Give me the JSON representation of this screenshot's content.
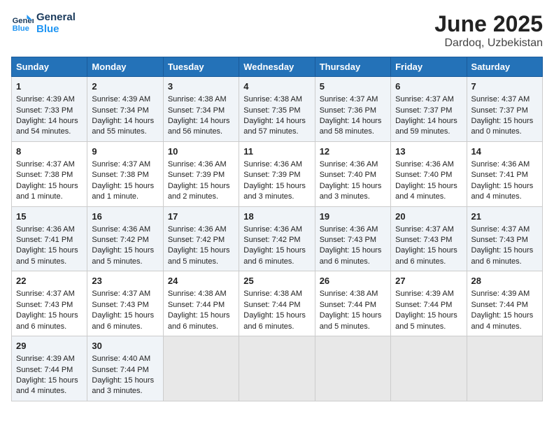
{
  "logo": {
    "line1": "General",
    "line2": "Blue"
  },
  "title": "June 2025",
  "subtitle": "Dardoq, Uzbekistan",
  "days_of_week": [
    "Sunday",
    "Monday",
    "Tuesday",
    "Wednesday",
    "Thursday",
    "Friday",
    "Saturday"
  ],
  "weeks": [
    [
      {
        "day": 1,
        "lines": [
          "Sunrise: 4:39 AM",
          "Sunset: 7:33 PM",
          "Daylight: 14 hours",
          "and 54 minutes."
        ]
      },
      {
        "day": 2,
        "lines": [
          "Sunrise: 4:39 AM",
          "Sunset: 7:34 PM",
          "Daylight: 14 hours",
          "and 55 minutes."
        ]
      },
      {
        "day": 3,
        "lines": [
          "Sunrise: 4:38 AM",
          "Sunset: 7:34 PM",
          "Daylight: 14 hours",
          "and 56 minutes."
        ]
      },
      {
        "day": 4,
        "lines": [
          "Sunrise: 4:38 AM",
          "Sunset: 7:35 PM",
          "Daylight: 14 hours",
          "and 57 minutes."
        ]
      },
      {
        "day": 5,
        "lines": [
          "Sunrise: 4:37 AM",
          "Sunset: 7:36 PM",
          "Daylight: 14 hours",
          "and 58 minutes."
        ]
      },
      {
        "day": 6,
        "lines": [
          "Sunrise: 4:37 AM",
          "Sunset: 7:37 PM",
          "Daylight: 14 hours",
          "and 59 minutes."
        ]
      },
      {
        "day": 7,
        "lines": [
          "Sunrise: 4:37 AM",
          "Sunset: 7:37 PM",
          "Daylight: 15 hours",
          "and 0 minutes."
        ]
      }
    ],
    [
      {
        "day": 8,
        "lines": [
          "Sunrise: 4:37 AM",
          "Sunset: 7:38 PM",
          "Daylight: 15 hours",
          "and 1 minute."
        ]
      },
      {
        "day": 9,
        "lines": [
          "Sunrise: 4:37 AM",
          "Sunset: 7:38 PM",
          "Daylight: 15 hours",
          "and 1 minute."
        ]
      },
      {
        "day": 10,
        "lines": [
          "Sunrise: 4:36 AM",
          "Sunset: 7:39 PM",
          "Daylight: 15 hours",
          "and 2 minutes."
        ]
      },
      {
        "day": 11,
        "lines": [
          "Sunrise: 4:36 AM",
          "Sunset: 7:39 PM",
          "Daylight: 15 hours",
          "and 3 minutes."
        ]
      },
      {
        "day": 12,
        "lines": [
          "Sunrise: 4:36 AM",
          "Sunset: 7:40 PM",
          "Daylight: 15 hours",
          "and 3 minutes."
        ]
      },
      {
        "day": 13,
        "lines": [
          "Sunrise: 4:36 AM",
          "Sunset: 7:40 PM",
          "Daylight: 15 hours",
          "and 4 minutes."
        ]
      },
      {
        "day": 14,
        "lines": [
          "Sunrise: 4:36 AM",
          "Sunset: 7:41 PM",
          "Daylight: 15 hours",
          "and 4 minutes."
        ]
      }
    ],
    [
      {
        "day": 15,
        "lines": [
          "Sunrise: 4:36 AM",
          "Sunset: 7:41 PM",
          "Daylight: 15 hours",
          "and 5 minutes."
        ]
      },
      {
        "day": 16,
        "lines": [
          "Sunrise: 4:36 AM",
          "Sunset: 7:42 PM",
          "Daylight: 15 hours",
          "and 5 minutes."
        ]
      },
      {
        "day": 17,
        "lines": [
          "Sunrise: 4:36 AM",
          "Sunset: 7:42 PM",
          "Daylight: 15 hours",
          "and 5 minutes."
        ]
      },
      {
        "day": 18,
        "lines": [
          "Sunrise: 4:36 AM",
          "Sunset: 7:42 PM",
          "Daylight: 15 hours",
          "and 6 minutes."
        ]
      },
      {
        "day": 19,
        "lines": [
          "Sunrise: 4:36 AM",
          "Sunset: 7:43 PM",
          "Daylight: 15 hours",
          "and 6 minutes."
        ]
      },
      {
        "day": 20,
        "lines": [
          "Sunrise: 4:37 AM",
          "Sunset: 7:43 PM",
          "Daylight: 15 hours",
          "and 6 minutes."
        ]
      },
      {
        "day": 21,
        "lines": [
          "Sunrise: 4:37 AM",
          "Sunset: 7:43 PM",
          "Daylight: 15 hours",
          "and 6 minutes."
        ]
      }
    ],
    [
      {
        "day": 22,
        "lines": [
          "Sunrise: 4:37 AM",
          "Sunset: 7:43 PM",
          "Daylight: 15 hours",
          "and 6 minutes."
        ]
      },
      {
        "day": 23,
        "lines": [
          "Sunrise: 4:37 AM",
          "Sunset: 7:43 PM",
          "Daylight: 15 hours",
          "and 6 minutes."
        ]
      },
      {
        "day": 24,
        "lines": [
          "Sunrise: 4:38 AM",
          "Sunset: 7:44 PM",
          "Daylight: 15 hours",
          "and 6 minutes."
        ]
      },
      {
        "day": 25,
        "lines": [
          "Sunrise: 4:38 AM",
          "Sunset: 7:44 PM",
          "Daylight: 15 hours",
          "and 6 minutes."
        ]
      },
      {
        "day": 26,
        "lines": [
          "Sunrise: 4:38 AM",
          "Sunset: 7:44 PM",
          "Daylight: 15 hours",
          "and 5 minutes."
        ]
      },
      {
        "day": 27,
        "lines": [
          "Sunrise: 4:39 AM",
          "Sunset: 7:44 PM",
          "Daylight: 15 hours",
          "and 5 minutes."
        ]
      },
      {
        "day": 28,
        "lines": [
          "Sunrise: 4:39 AM",
          "Sunset: 7:44 PM",
          "Daylight: 15 hours",
          "and 4 minutes."
        ]
      }
    ],
    [
      {
        "day": 29,
        "lines": [
          "Sunrise: 4:39 AM",
          "Sunset: 7:44 PM",
          "Daylight: 15 hours",
          "and 4 minutes."
        ]
      },
      {
        "day": 30,
        "lines": [
          "Sunrise: 4:40 AM",
          "Sunset: 7:44 PM",
          "Daylight: 15 hours",
          "and 3 minutes."
        ]
      },
      null,
      null,
      null,
      null,
      null
    ]
  ]
}
